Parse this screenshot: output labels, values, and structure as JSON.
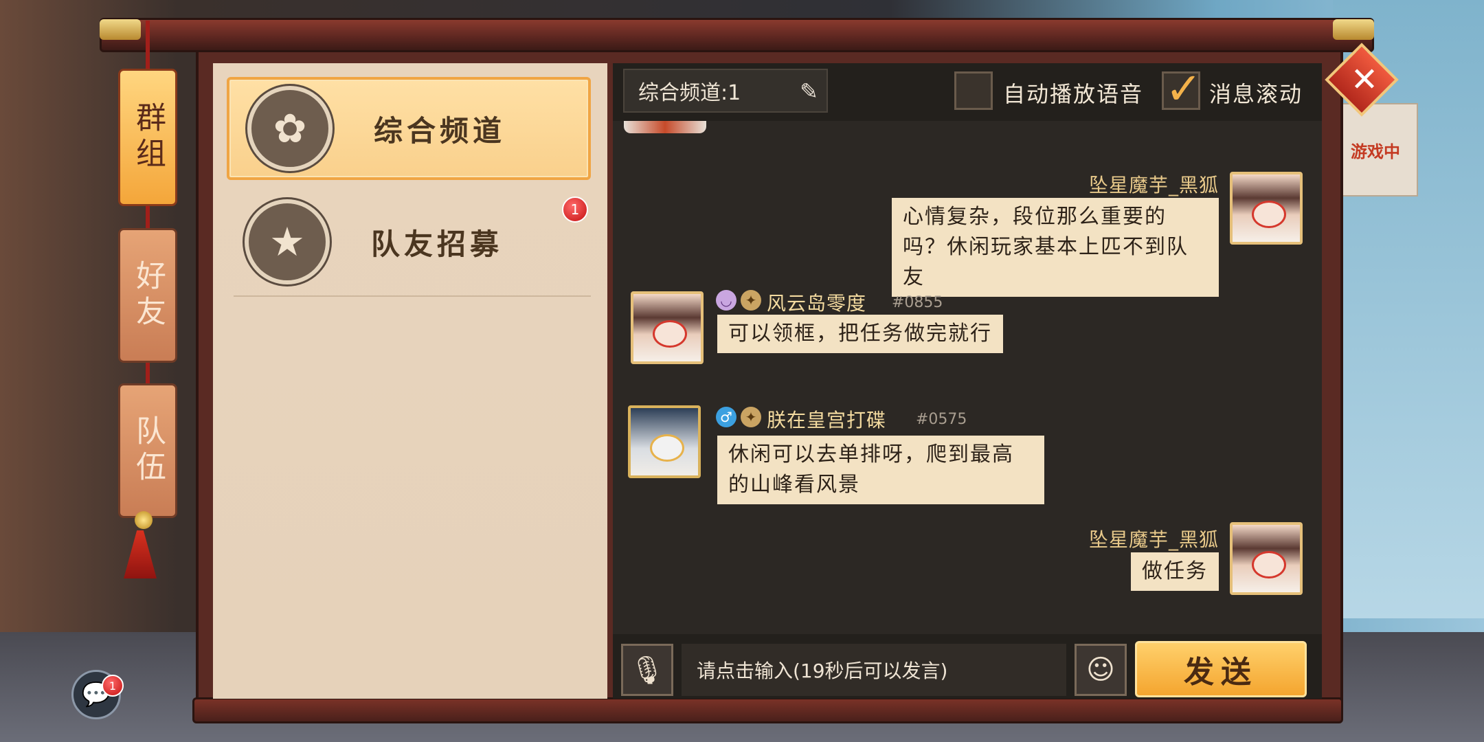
{
  "tabs": [
    {
      "label": "群组",
      "active": true
    },
    {
      "label": "好友",
      "active": false
    },
    {
      "label": "队伍",
      "active": false
    }
  ],
  "channels": [
    {
      "label": "综合频道",
      "icon": "flower-icon",
      "active": true,
      "badge": ""
    },
    {
      "label": "队友招募",
      "icon": "star-banner-icon",
      "active": false,
      "badge": "1"
    }
  ],
  "header": {
    "channel_name": "综合频道:1",
    "auto_voice_label": "自动播放语音",
    "auto_voice_checked": false,
    "scroll_label": "消息滚动",
    "scroll_checked": true
  },
  "messages": [
    {
      "side": "right",
      "sender": "坠星魔芋_黑狐",
      "tag": "",
      "text": "心情复杂，段位那么重要的吗？休闲玩家基本上匹不到队友"
    },
    {
      "side": "left",
      "sender": "风云岛零度",
      "tag": "#0855",
      "text": "可以领框，把任务做完就行"
    },
    {
      "side": "left",
      "sender": "朕在皇宫打碟",
      "tag": "#0575",
      "text": "休闲可以去单排呀，爬到最高的山峰看风景"
    },
    {
      "side": "right",
      "sender": "坠星魔芋_黑狐",
      "tag": "",
      "text": "做任务"
    }
  ],
  "input": {
    "placeholder": "请点击输入(19秒后可以发言)",
    "send_label": "发送"
  },
  "floating_chat_badge": "1",
  "background_status": "游戏中",
  "colors": {
    "accent": "#f4a52f",
    "bubble": "#f3e2c3",
    "badge": "#c40f0f"
  }
}
